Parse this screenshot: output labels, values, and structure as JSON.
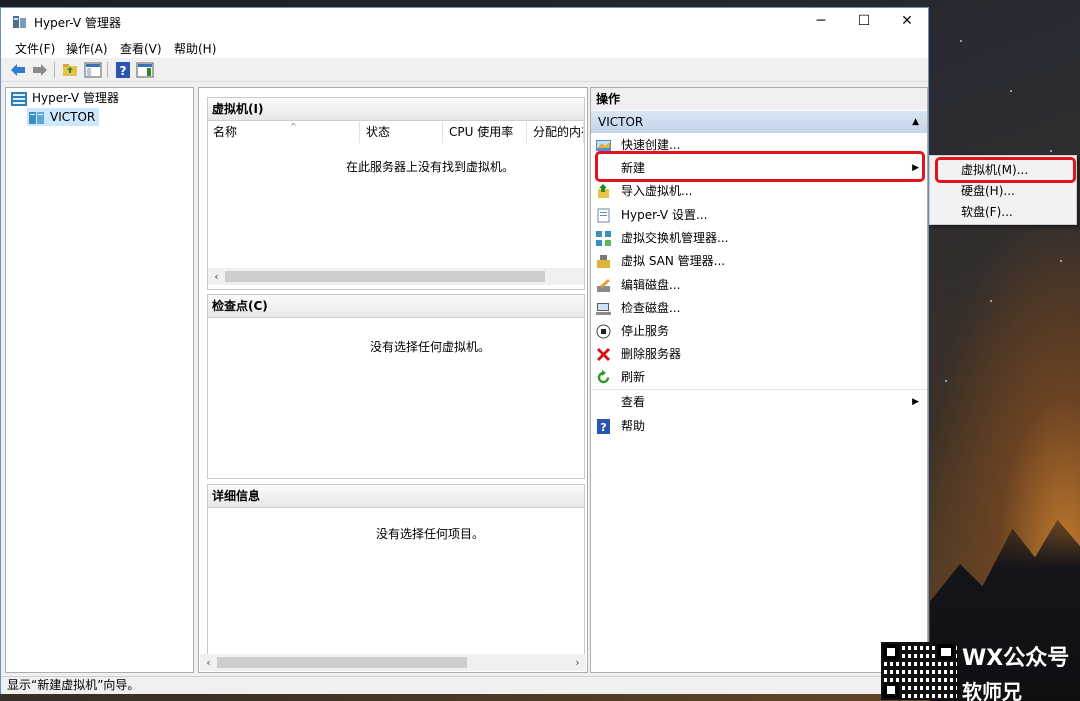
{
  "window": {
    "title": "Hyper-V 管理器",
    "controls": {
      "minimize": "─",
      "maximize": "☐",
      "close": "✕"
    }
  },
  "menubar": {
    "items": [
      "文件(F)",
      "操作(A)",
      "查看(V)",
      "帮助(H)"
    ]
  },
  "toolbar": {
    "buttons": [
      "back-icon",
      "forward-icon",
      "up-folder-icon",
      "show-tree-icon",
      "help-icon",
      "show-actions-icon"
    ]
  },
  "tree": {
    "root": "Hyper-V 管理器",
    "server": "VICTOR"
  },
  "vm_pane": {
    "title": "虚拟机(I)",
    "columns": [
      "名称",
      "状态",
      "CPU 使用率",
      "分配的内存"
    ],
    "empty_message": "在此服务器上没有找到虚拟机。"
  },
  "checkpoint_pane": {
    "title": "检查点(C)",
    "empty_message": "没有选择任何虚拟机。"
  },
  "details_pane": {
    "title": "详细信息",
    "empty_message": "没有选择任何项目。"
  },
  "actions": {
    "title": "操作",
    "group": "VICTOR",
    "items": [
      {
        "label": "快速创建...",
        "icon": "quick-create-icon"
      },
      {
        "label": "新建",
        "icon": "",
        "submenu": true
      },
      {
        "label": "导入虚拟机...",
        "icon": "import-icon"
      },
      {
        "label": "Hyper-V 设置...",
        "icon": "settings-icon"
      },
      {
        "label": "虚拟交换机管理器...",
        "icon": "switch-icon"
      },
      {
        "label": "虚拟 SAN 管理器...",
        "icon": "san-icon"
      },
      {
        "label": "编辑磁盘...",
        "icon": "edit-disk-icon"
      },
      {
        "label": "检查磁盘...",
        "icon": "inspect-disk-icon"
      },
      {
        "label": "停止服务",
        "icon": "stop-icon"
      },
      {
        "label": "删除服务器",
        "icon": "delete-icon"
      },
      {
        "label": "刷新",
        "icon": "refresh-icon"
      },
      {
        "label": "查看",
        "icon": "",
        "submenu": true
      },
      {
        "label": "帮助",
        "icon": "help-icon"
      }
    ]
  },
  "submenu": {
    "items": [
      "虚拟机(M)...",
      "硬盘(H)...",
      "软盘(F)..."
    ]
  },
  "statusbar": {
    "text": "显示“新建虚拟机”向导。"
  },
  "watermark": {
    "line1": "WX公众号",
    "line2": "软师兄"
  },
  "colors": {
    "highlight": "#e0141c",
    "group_header": "#c9d9ec",
    "tree_selected": "#cce8ff"
  }
}
